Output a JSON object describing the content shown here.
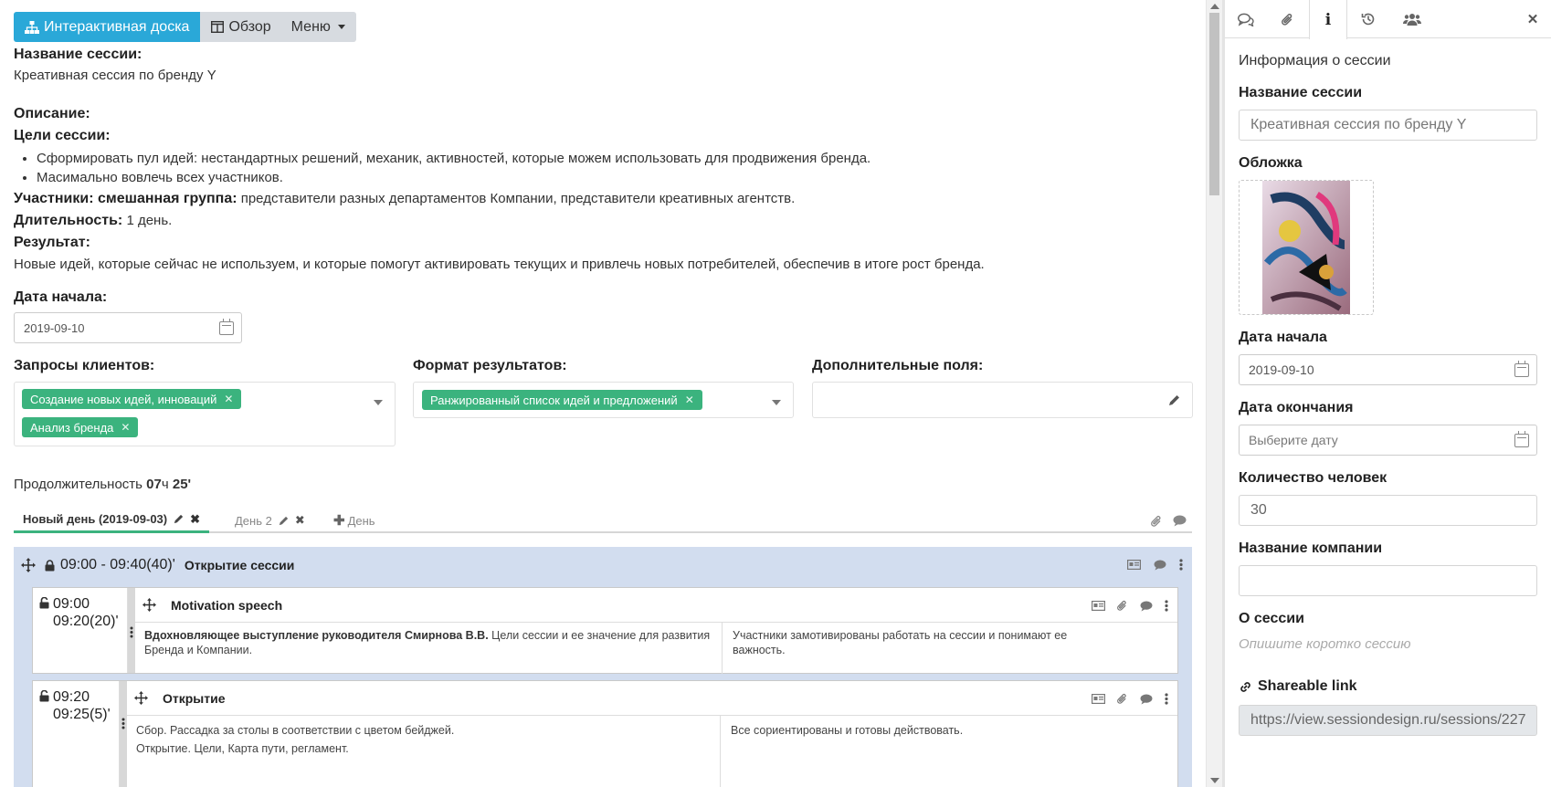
{
  "toolbar": {
    "board_label": "Интерактивная доска",
    "overview_label": "Обзор",
    "menu_label": "Меню"
  },
  "session": {
    "name_label": "Название сессии:",
    "name_value": "Креативная сессия по бренду Y",
    "description_label": "Описание:",
    "goals_label": "Цели сессии:",
    "goals": [
      "Сформировать пул идей: нестандартных решений, механик, активностей, которые можем использовать для продвижения бренда.",
      "Масимально вовлечь всех участников."
    ],
    "participants_label": "Участники: смешанная группа:",
    "participants_value": "представители разных департаментов Компании, представители креативных агентств.",
    "duration_label": "Длительность:",
    "duration_value": "1 день.",
    "result_label": "Результат:",
    "result_value": "Новые идей, которые сейчас не используем, и которые помогут активировать текущих и привлечь новых потребителей, обеспечив в итоге рост бренда.",
    "start_label": "Дата начала:",
    "start_value": "2019-09-10"
  },
  "fields": {
    "requests_label": "Запросы клиентов:",
    "requests_tags": [
      "Создание новых идей, инноваций",
      "Анализ бренда"
    ],
    "format_label": "Формат результатов:",
    "format_tags": [
      "Ранжированный список идей и предложений"
    ],
    "extra_label": "Дополнительные поля:"
  },
  "totals": {
    "prefix": "Продолжительность",
    "hours": "07",
    "hours_unit": "ч",
    "minutes": "25",
    "minutes_unit": "'"
  },
  "day_tabs": {
    "day1": "Новый день (2019-09-03)",
    "day2": "День 2",
    "add_day": "День"
  },
  "block": {
    "time": "09:00 - 09:40(40)'",
    "title": "Открытие сессии"
  },
  "items": [
    {
      "time_start": "09:00",
      "time_end": "09:20(20)'",
      "title": "Motivation speech",
      "desc_bold": "Вдохновляющее выступление руководителя Смирнова В.В.",
      "desc_rest": "Цели сессии и ее значение для развития",
      "desc_line2": "Бренда и Компании.",
      "result_line1": "Участники замотивированы работать на сессии и понимают ее",
      "result_line2": "важность."
    },
    {
      "time_start": "09:20",
      "time_end": "09:25(5)'",
      "title": "Открытие",
      "desc_line1": "Сбор. Рассадка за столы в соответствии с цветом бейджей.",
      "desc_line2": "Открытие. Цели, Карта пути, регламент.",
      "result_line1": "Все сориентированы и готовы действовать."
    }
  ],
  "panel": {
    "header": "Информация о сессии",
    "name_label": "Название сессии",
    "name_placeholder": "Креативная сессия по бренду Y",
    "cover_label": "Обложка",
    "start_label": "Дата начала",
    "start_value": "2019-09-10",
    "end_label": "Дата окончания",
    "end_placeholder": "Выберите дату",
    "people_label": "Количество человек",
    "people_value": "30",
    "company_label": "Название компании",
    "company_value": "",
    "about_label": "О сессии",
    "about_placeholder": "Опишите коротко сессию",
    "link_label": "Shareable link",
    "link_value": "https://view.sessiondesign.ru/sessions/227"
  },
  "colors": {
    "primary": "#2aa8d8",
    "tag_green": "#3bb37e",
    "block_bg": "#d2ddef"
  }
}
